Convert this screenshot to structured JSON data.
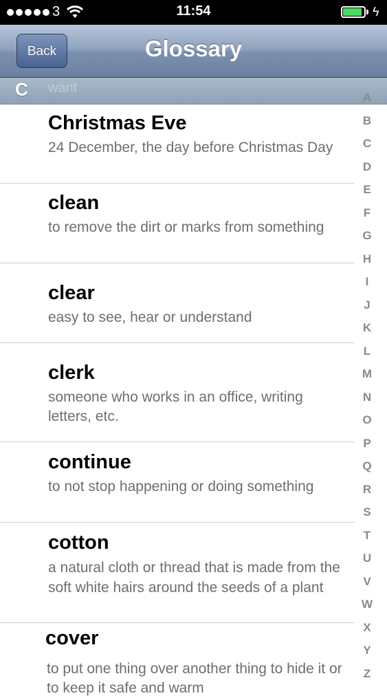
{
  "status_bar": {
    "carrier": "3",
    "time": "11:54",
    "battery_level": 0.95
  },
  "nav": {
    "back_label": "Back",
    "title": "Glossary"
  },
  "section": {
    "letter": "C",
    "ghost_text": "want"
  },
  "entries": [
    {
      "term": "Christmas Eve",
      "definition": "24 December, the day before Christmas Day"
    },
    {
      "term": "clean",
      "definition": "to remove the dirt or marks from something"
    },
    {
      "term": "clear",
      "definition": "easy to see, hear or understand"
    },
    {
      "term": "clerk",
      "definition": "someone who works in an office, writing letters, etc."
    },
    {
      "term": "continue",
      "definition": "to not stop happening or doing something"
    },
    {
      "term": "cotton",
      "definition": "a natural cloth or thread that is made from the soft white hairs around the seeds of a plant"
    },
    {
      "term": "cover",
      "definition": "to put one thing over another thing to hide it or to keep it safe and warm"
    }
  ],
  "index_letters": [
    "A",
    "B",
    "C",
    "D",
    "E",
    "F",
    "G",
    "H",
    "I",
    "J",
    "K",
    "L",
    "M",
    "N",
    "O",
    "P",
    "Q",
    "R",
    "S",
    "T",
    "U",
    "V",
    "W",
    "X",
    "Y",
    "Z"
  ]
}
